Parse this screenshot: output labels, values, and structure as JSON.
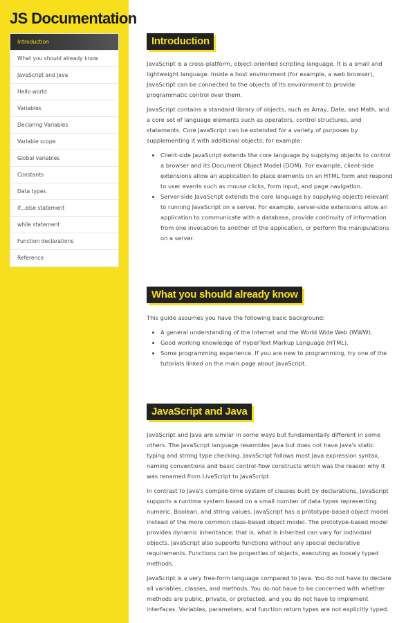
{
  "sidebar": {
    "title": "JS Documentation",
    "items": [
      {
        "label": "Introduction",
        "active": true
      },
      {
        "label": "What you should already know",
        "active": false
      },
      {
        "label": "JavaScript and Java",
        "active": false
      },
      {
        "label": "Hello world",
        "active": false
      },
      {
        "label": "Variables",
        "active": false
      },
      {
        "label": "Declaring Variables",
        "active": false
      },
      {
        "label": "Variable scope",
        "active": false
      },
      {
        "label": "Global variables",
        "active": false
      },
      {
        "label": "Constants",
        "active": false
      },
      {
        "label": "Data types",
        "active": false
      },
      {
        "label": "if...else statement",
        "active": false
      },
      {
        "label": "while statement",
        "active": false
      },
      {
        "label": "Function declarations",
        "active": false
      },
      {
        "label": "Reference",
        "active": false
      }
    ]
  },
  "sections": {
    "introduction": {
      "heading": "Introduction",
      "paragraphs": [
        "JavaScript is a cross-platform, object-oriented scripting language. It is a small and lightweight language. Inside a host environment (for example, a web browser), JavaScript can be connected to the objects of its environment to provide programmatic control over them.",
        "JavaScript contains a standard library of objects, such as Array, Date, and Math, and a core set of language elements such as operators, control structures, and statements. Core JavaScript can be extended for a variety of purposes by supplementing it with additional objects; for example:"
      ],
      "bullets": [
        "Client-side JavaScript extends the core language by supplying objects to control a browser and its Document Object Model (DOM). For example, client-side extensions allow an application to place elements on an HTML form and respond to user events such as mouse clicks, form input, and page navigation.",
        "Server-side JavaScript extends the core language by supplying objects relevant to running JavaScript on a server. For example, server-side extensions allow an application to communicate with a database, provide continuity of information from one invocation to another of the application, or perform file manipulations on a server."
      ]
    },
    "what_you_should_know": {
      "heading": "What you should already know",
      "paragraphs": [
        "This guide assumes you have the following basic background:"
      ],
      "bullets": [
        "A general understanding of the Internet and the World Wide Web (WWW).",
        "Good working knowledge of HyperText Markup Language (HTML).",
        "Some programming experience. If you are new to programming, try one of the tutorials linked on the main page about JavaScript."
      ]
    },
    "javascript_and_java": {
      "heading": "JavaScript and Java",
      "paragraphs": [
        "JavaScript and Java are similar in some ways but fundamentally different in some others. The JavaScript language resembles Java but does not have Java's static typing and strong type checking. JavaScript follows most Java expression syntax, naming conventions and basic control-flow constructs which was the reason why it was renamed from LiveScript to JavaScript.",
        "In contrast to Java's compile-time system of classes built by declarations, JavaScript supports a runtime system based on a small number of data types representing numeric, Boolean, and string values. JavaScript has a prototype-based object model instead of the more common class-based object model. The prototype-based model provides dynamic inheritance; that is, what is inherited can vary for individual objects. JavaScript also supports functions without any special declarative requirements. Functions can be properties of objects, executing as loosely typed methods.",
        "JavaScript is a very free-form language compared to Java. You do not have to declare all variables, classes, and methods. You do not have to be concerned with whether methods are public, private, or protected, and you do not have to implement interfaces. Variables, parameters, and function return types are not explicitly typed."
      ]
    }
  }
}
